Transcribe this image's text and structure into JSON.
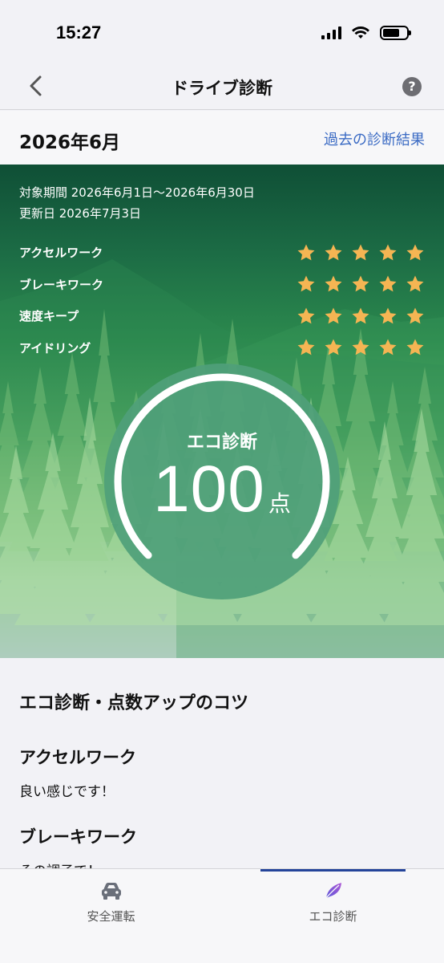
{
  "status_bar": {
    "time": "15:27"
  },
  "nav": {
    "title": "ドライブ診断",
    "back_icon": "chevron-left-icon",
    "help_icon": "question-icon",
    "help_glyph": "?"
  },
  "header": {
    "month": "2026年6月",
    "past_results_link": "過去の診断結果"
  },
  "period": {
    "range": "対象期間 2026年6月1日〜2026年6月30日",
    "updated": "更新日 2026年7月3日"
  },
  "ratings": [
    {
      "label": "アクセルワーク",
      "stars": 5
    },
    {
      "label": "ブレーキワーク",
      "stars": 5
    },
    {
      "label": "速度キープ",
      "stars": 5
    },
    {
      "label": "アイドリング",
      "stars": 5
    }
  ],
  "eco": {
    "label": "エコ診断",
    "score": "100",
    "unit": "点",
    "score_fraction": 1.0
  },
  "tips": {
    "heading": "エコ診断・点数アップのコツ",
    "items": [
      {
        "title": "アクセルワーク",
        "text": "良い感じです！"
      },
      {
        "title": "ブレーキワーク",
        "text": "その調子で！"
      }
    ]
  },
  "tabbar": {
    "tabs": [
      {
        "label": "安全運転",
        "icon": "car-icon",
        "active": false
      },
      {
        "label": "エコ診断",
        "icon": "leaf-icon",
        "active": true
      }
    ]
  },
  "colors": {
    "star": "#f5b553",
    "link": "#3b6bc4",
    "tab_indicator": "#24449a",
    "leaf": "#7b4fd6"
  }
}
